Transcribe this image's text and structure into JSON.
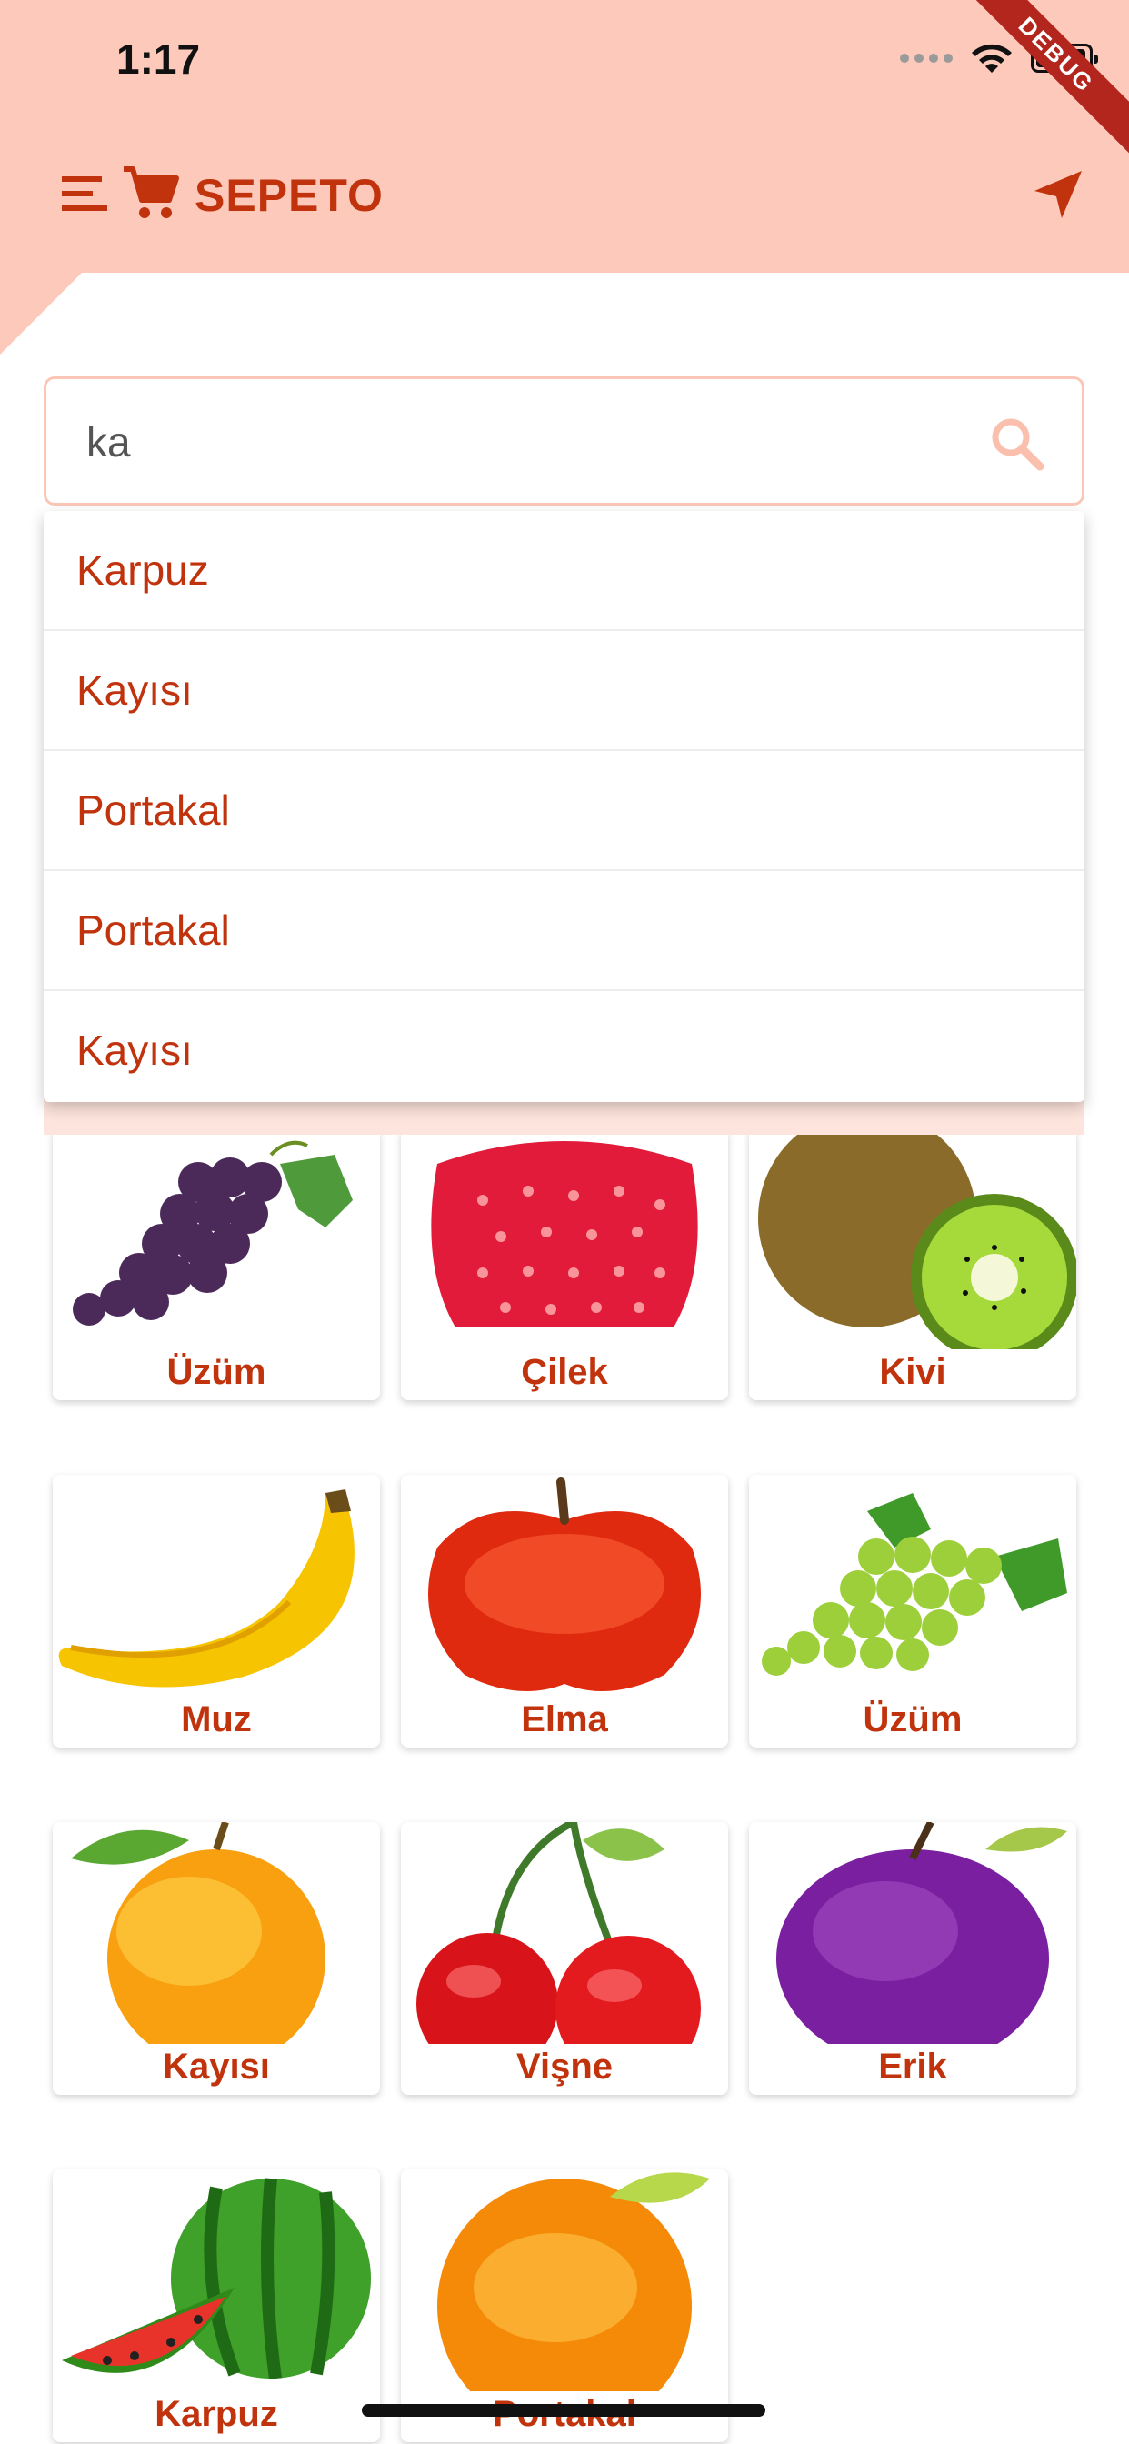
{
  "status": {
    "time": "1:17"
  },
  "debug_label": "DEBUG",
  "app": {
    "title": "SEPETO",
    "accent": "#c0330d",
    "header_bg": "#fdc9bb"
  },
  "search": {
    "value": "ka"
  },
  "suggestions": [
    "Karpuz",
    "Kayısı",
    "Portakal",
    "Portakal",
    "Kayısı"
  ],
  "products": [
    {
      "name": "Üzüm",
      "image": "purple-grapes"
    },
    {
      "name": "Çilek",
      "image": "strawberry"
    },
    {
      "name": "Kivi",
      "image": "kiwi"
    },
    {
      "name": "Muz",
      "image": "banana"
    },
    {
      "name": "Elma",
      "image": "apple"
    },
    {
      "name": "Üzüm",
      "image": "green-grapes"
    },
    {
      "name": "Kayısı",
      "image": "apricot"
    },
    {
      "name": "Vişne",
      "image": "cherry"
    },
    {
      "name": "Erik",
      "image": "plum"
    },
    {
      "name": "Karpuz",
      "image": "watermelon"
    },
    {
      "name": "Portakal",
      "image": "orange"
    }
  ]
}
